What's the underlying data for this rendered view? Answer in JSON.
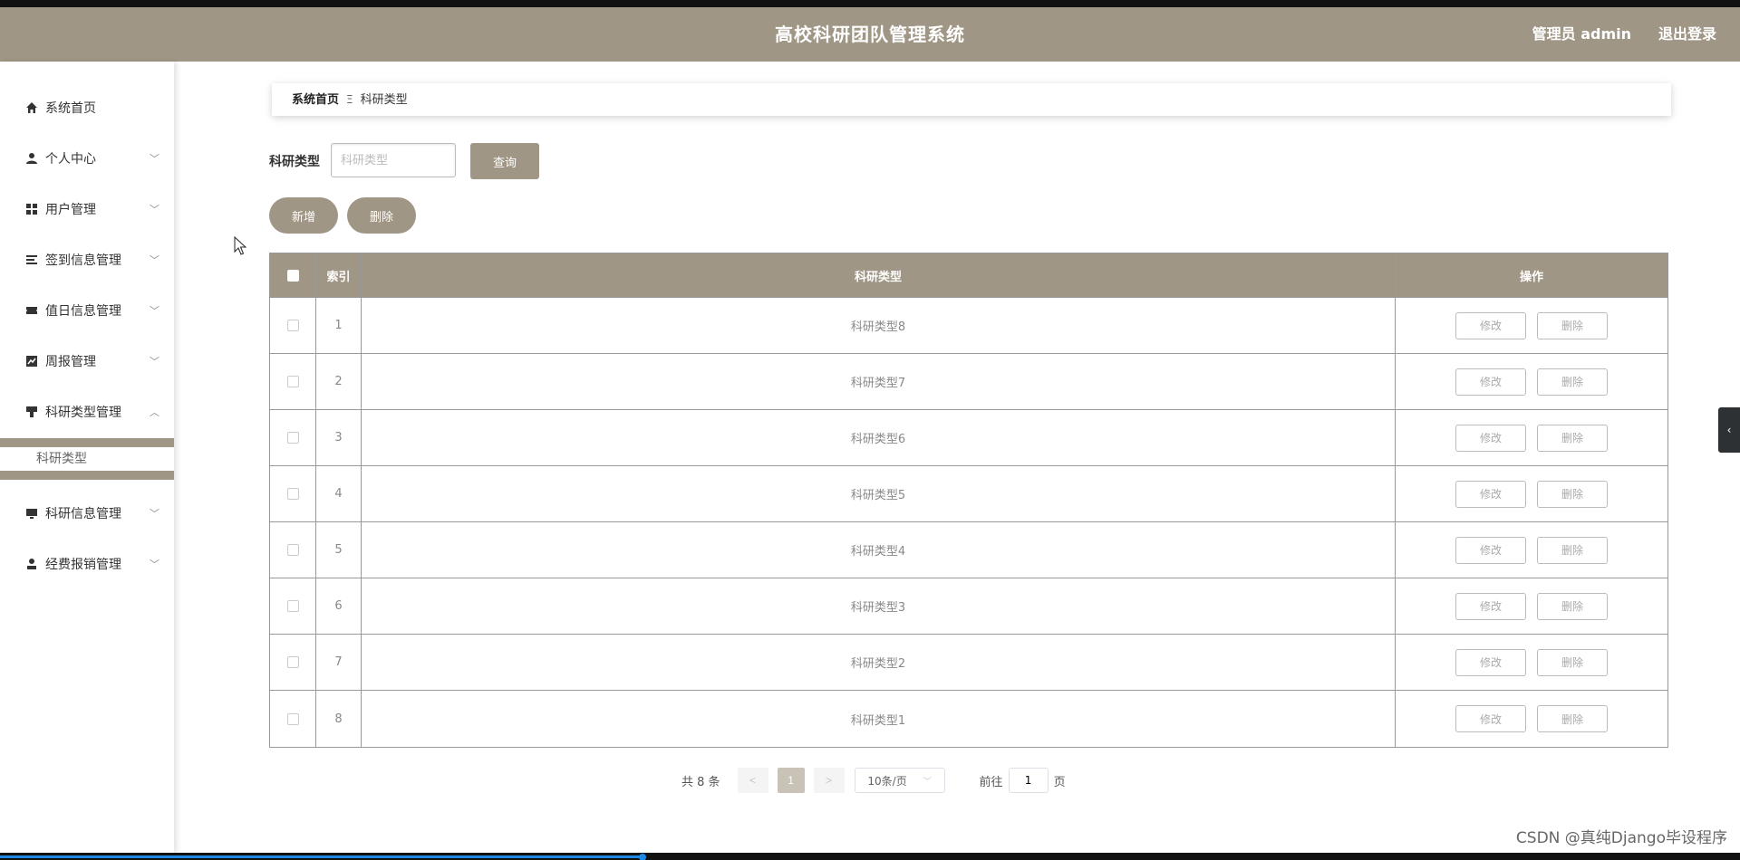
{
  "header": {
    "title": "高校科研团队管理系统",
    "user": "管理员 admin",
    "logout": "退出登录",
    "bg_color": "#a09685"
  },
  "sidebar": {
    "items": [
      {
        "label": "系统首页",
        "icon": "home-icon"
      },
      {
        "label": "个人中心",
        "icon": "user-icon"
      },
      {
        "label": "用户管理",
        "icon": "grid-icon"
      },
      {
        "label": "签到信息管理",
        "icon": "list-icon"
      },
      {
        "label": "值日信息管理",
        "icon": "ticket-icon"
      },
      {
        "label": "周报管理",
        "icon": "chart-icon"
      },
      {
        "label": "科研类型管理",
        "icon": "stamp-icon"
      },
      {
        "label": "科研信息管理",
        "icon": "monitor-icon"
      },
      {
        "label": "经费报销管理",
        "icon": "person-icon"
      }
    ],
    "sub_item": "科研类型"
  },
  "breadcrumb": {
    "home": "系统首页",
    "separator": "Ξ",
    "current": "科研类型"
  },
  "search": {
    "label": "科研类型",
    "placeholder": "科研类型",
    "button": "查询"
  },
  "actions": {
    "add": "新增",
    "delete": "删除"
  },
  "table": {
    "headers": {
      "index": "索引",
      "type": "科研类型",
      "ops": "操作"
    },
    "edit_label": "修改",
    "delete_label": "删除",
    "rows": [
      {
        "index": "1",
        "type": "科研类型8"
      },
      {
        "index": "2",
        "type": "科研类型7"
      },
      {
        "index": "3",
        "type": "科研类型6"
      },
      {
        "index": "4",
        "type": "科研类型5"
      },
      {
        "index": "5",
        "type": "科研类型4"
      },
      {
        "index": "6",
        "type": "科研类型3"
      },
      {
        "index": "7",
        "type": "科研类型2"
      },
      {
        "index": "8",
        "type": "科研类型1"
      }
    ]
  },
  "pagination": {
    "total": "共 8 条",
    "prev": "<",
    "current_page": "1",
    "next": ">",
    "page_size": "10条/页",
    "goto_prefix": "前往",
    "goto_value": "1",
    "goto_suffix": "页"
  },
  "watermark": "CSDN @真纯Django毕设程序",
  "side_tab": "‹"
}
